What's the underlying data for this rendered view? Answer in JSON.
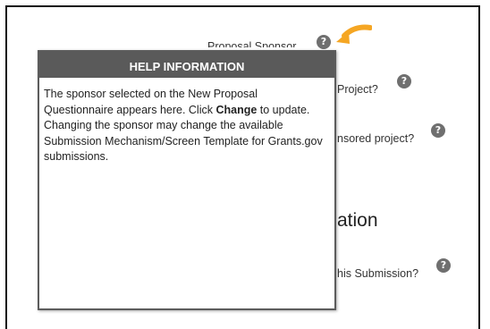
{
  "background": {
    "field_1_label": "Proposal Sponsor",
    "field_2_label_fragment": "Project?",
    "field_3_label_fragment": "nsored project?",
    "section_heading_fragment": "ation",
    "field_4_label_fragment": "his Submission?"
  },
  "help_popup": {
    "title": "HELP INFORMATION",
    "text_before": "The sponsor selected on the New Proposal Questionnaire appears here. Click ",
    "bold_word": "Change",
    "text_after": " to update. Changing the sponsor may change the available Submission Mechanism/Screen Template for Grants.gov submissions."
  },
  "icons": {
    "help_glyph": "?",
    "help_icon": "question-circle-icon",
    "pointer_icon": "orange-arrow-icon"
  },
  "colors": {
    "accent_arrow": "#f5a623",
    "popup_header": "#5a5a5a",
    "help_icon": "#6f6f6f"
  }
}
